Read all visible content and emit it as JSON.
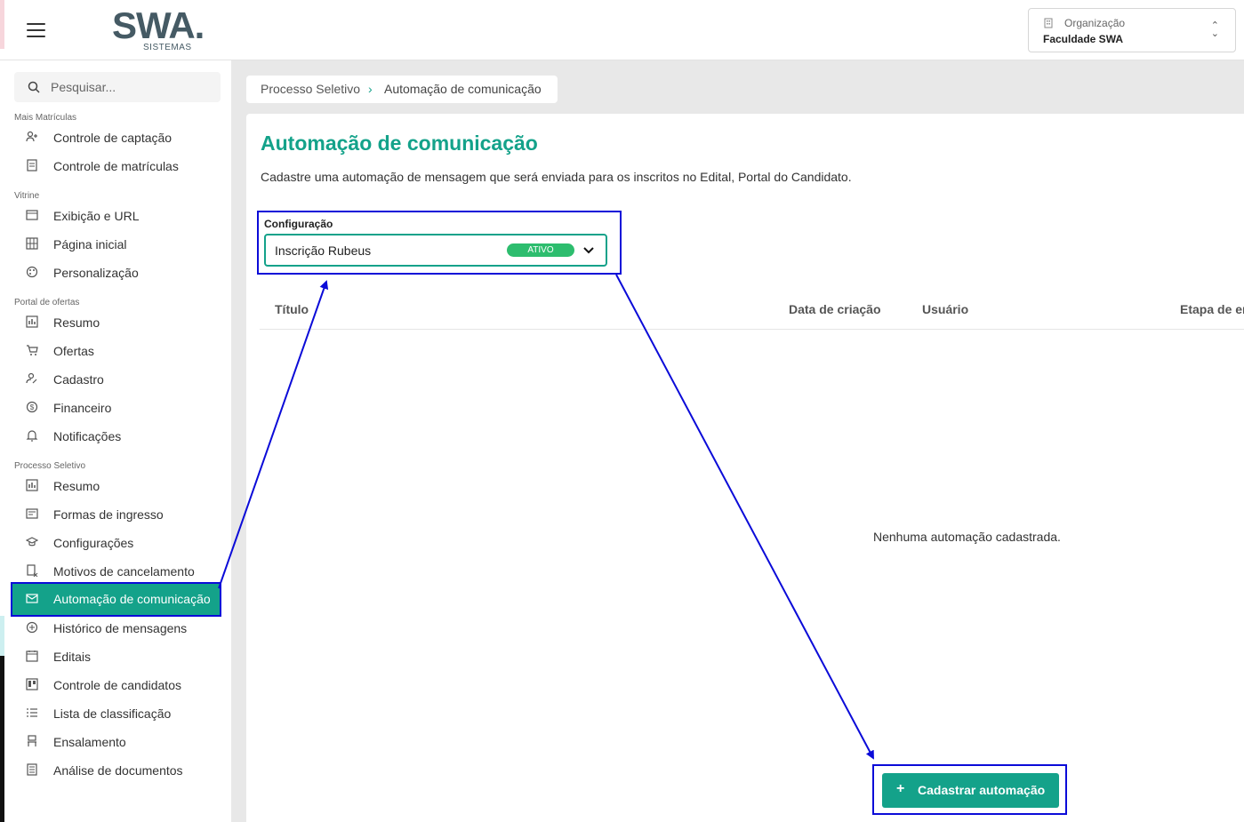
{
  "brand": {
    "logo_text": "SWA",
    "logo_dot": ".",
    "logo_sub": "SISTEMAS",
    "accent": "#14a28a",
    "annotation_color": "#0b0bd8"
  },
  "org": {
    "label": "Organização",
    "value": "Faculdade SWA"
  },
  "search": {
    "placeholder": "Pesquisar..."
  },
  "sidebar": {
    "sections": [
      "Mais Matrículas",
      "Vitrine",
      "Portal de ofertas",
      "Processo Seletivo"
    ],
    "items": [
      {
        "label": "Controle de captação",
        "icon": "user-plus-icon"
      },
      {
        "label": "Controle de matrículas",
        "icon": "document-icon"
      },
      {
        "label": "Exibição e URL",
        "icon": "storefront-icon"
      },
      {
        "label": "Página inicial",
        "icon": "grid-icon"
      },
      {
        "label": "Personalização",
        "icon": "palette-icon"
      },
      {
        "label": "Resumo",
        "icon": "chart-icon"
      },
      {
        "label": "Ofertas",
        "icon": "cart-icon"
      },
      {
        "label": "Cadastro",
        "icon": "user-edit-icon"
      },
      {
        "label": "Financeiro",
        "icon": "dollar-icon"
      },
      {
        "label": "Notificações",
        "icon": "bell-icon"
      },
      {
        "label": "Resumo",
        "icon": "chart-icon"
      },
      {
        "label": "Formas de ingresso",
        "icon": "form-icon"
      },
      {
        "label": "Configurações",
        "icon": "graduation-cap-icon"
      },
      {
        "label": "Motivos de cancelamento",
        "icon": "document-x-icon"
      },
      {
        "label": "Automação de comunicação",
        "icon": "mail-automation-icon"
      },
      {
        "label": "Histórico de mensagens",
        "icon": "message-history-icon"
      },
      {
        "label": "Editais",
        "icon": "calendar-icon"
      },
      {
        "label": "Controle de candidatos",
        "icon": "kanban-icon"
      },
      {
        "label": "Lista de classificação",
        "icon": "list-icon"
      },
      {
        "label": "Ensalamento",
        "icon": "chair-icon"
      },
      {
        "label": "Análise de documentos",
        "icon": "document-lines-icon"
      }
    ]
  },
  "breadcrumb": {
    "parent": "Processo Seletivo",
    "separator": "›",
    "current": "Automação de comunicação"
  },
  "page": {
    "title": "Automação de comunicação",
    "description": "Cadastre uma automação de mensagem que será enviada para os inscritos no Edital, Portal do Candidato."
  },
  "config": {
    "label": "Configuração",
    "value": "Inscrição Rubeus",
    "status": "ATIVO"
  },
  "table": {
    "headers": [
      "Título",
      "Data de criação",
      "Usuário",
      "Etapa de er"
    ]
  },
  "empty_message": "Nenhuma automação cadastrada.",
  "add_button": {
    "icon": "+",
    "label": "Cadastrar automação"
  }
}
